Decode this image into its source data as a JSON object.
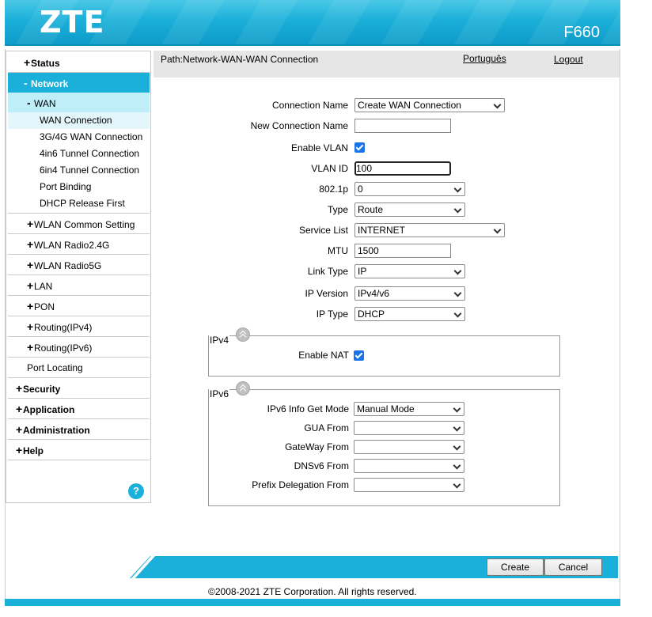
{
  "header": {
    "logo": "ZTE",
    "model": "F660"
  },
  "pathbar": {
    "path": "Path:Network-WAN-WAN Connection",
    "language": "Português",
    "logout": "Logout"
  },
  "sidebar": {
    "status": "Status",
    "network": "Network",
    "wan": "WAN",
    "wan_items": [
      "WAN Connection",
      "3G/4G WAN Connection",
      "4in6 Tunnel Connection",
      "6in4 Tunnel Connection",
      "Port Binding",
      "DHCP Release First"
    ],
    "network_items": [
      "WLAN Common Setting",
      "WLAN Radio2.4G",
      "WLAN Radio5G",
      "LAN",
      "PON",
      "Routing(IPv4)",
      "Routing(IPv6)"
    ],
    "port_locating": "Port Locating",
    "security": "Security",
    "application": "Application",
    "administration": "Administration",
    "help": "Help",
    "help_icon": "?",
    "plus": "+",
    "minus": "-"
  },
  "form": {
    "connection_name_label": "Connection Name",
    "connection_name_value": "Create WAN Connection",
    "new_connection_name_label": "New Connection Name",
    "new_connection_name_value": "",
    "enable_vlan_label": "Enable VLAN",
    "vlan_id_label": "VLAN ID",
    "vlan_id_value": "100",
    "p8021_label": "802.1p",
    "p8021_value": "0",
    "type_label": "Type",
    "type_value": "Route",
    "service_list_label": "Service List",
    "service_list_value": "INTERNET",
    "mtu_label": "MTU",
    "mtu_value": "1500",
    "link_type_label": "Link Type",
    "link_type_value": "IP",
    "ip_version_label": "IP Version",
    "ip_version_value": "IPv4/v6",
    "ip_type_label": "IP Type",
    "ip_type_value": "DHCP",
    "ipv4_legend": "IPv4",
    "enable_nat_label": "Enable NAT",
    "ipv6_legend": "IPv6",
    "ipv6_info_label": "IPv6 Info Get Mode",
    "ipv6_info_value": "Manual Mode",
    "gua_from_label": "GUA From",
    "gua_from_value": "",
    "gateway_from_label": "GateWay From",
    "gateway_from_value": "",
    "dnsv6_from_label": "DNSv6 From",
    "dnsv6_from_value": "",
    "prefix_delegation_label": "Prefix Delegation From",
    "prefix_delegation_value": ""
  },
  "buttons": {
    "create": "Create",
    "cancel": "Cancel"
  },
  "footer": {
    "copyright": "©2008-2021 ZTE Corporation. All rights reserved."
  },
  "colors": {
    "accent": "#1bb0d9",
    "accent_light": "#bfeef8",
    "checkbox": "#1a73e8"
  }
}
